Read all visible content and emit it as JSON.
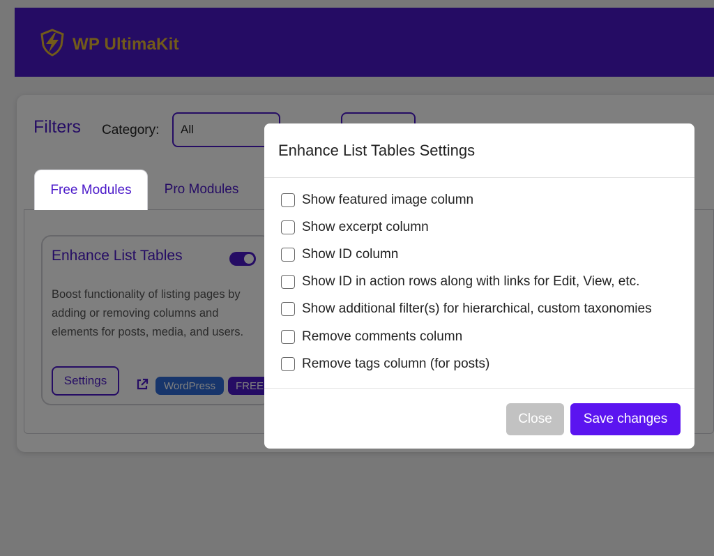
{
  "header": {
    "logo_text": "WP UltimaKit",
    "colors": {
      "bar": "#4a18c9",
      "logo": "#e4b635"
    },
    "icon": "lightning-shield-icon"
  },
  "filters": {
    "title": "Filters",
    "category_label": "Category:",
    "category_value": "All"
  },
  "tabs": [
    {
      "label": "Free Modules",
      "active": true
    },
    {
      "label": "Pro Modules",
      "active": false
    }
  ],
  "module_card": {
    "title": "Enhance List Tables",
    "enabled": true,
    "description": "Boost functionality of listing pages by adding or removing columns and elements for posts, media, and users.",
    "settings_label": "Settings",
    "badges": [
      "WordPress",
      "FREE"
    ],
    "link_icon": "external-link-icon"
  },
  "modal": {
    "title": "Enhance List Tables Settings",
    "options": [
      {
        "label": "Show featured image column",
        "checked": false
      },
      {
        "label": "Show excerpt column",
        "checked": false
      },
      {
        "label": "Show ID column",
        "checked": false
      },
      {
        "label": "Show ID in action rows along with links for Edit, View, etc.",
        "checked": false
      },
      {
        "label": "Show additional filter(s) for hierarchical, custom taxonomies",
        "checked": false
      },
      {
        "label": "Remove comments column",
        "checked": false
      },
      {
        "label": "Remove tags column (for posts)",
        "checked": false
      }
    ],
    "close_label": "Close",
    "save_label": "Save changes",
    "colors": {
      "close": "#c2c2c2",
      "save": "#5b14f0"
    }
  }
}
